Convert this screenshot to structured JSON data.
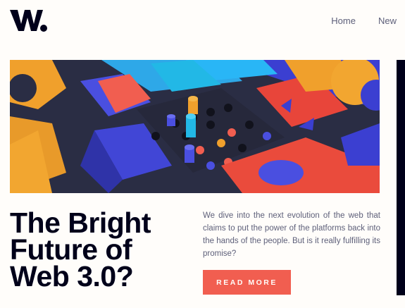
{
  "header": {
    "logo_text": "W.",
    "nav": [
      {
        "label": "Home"
      },
      {
        "label": "New"
      }
    ]
  },
  "hero": {
    "image_description": "3D colorful geometric blocks"
  },
  "article": {
    "title_lines": [
      "The Bright",
      "Future of",
      "Web 3.0?"
    ],
    "description": "We dive into the next evolution of the web that claims to put the power of the platforms back into the hands of the people. But is it really fulfilling its promise?",
    "cta_label": "READ MORE"
  },
  "colors": {
    "background": "#fffdfa",
    "ink": "#00001a",
    "muted": "#5d5f79",
    "accent": "#f15e50"
  }
}
